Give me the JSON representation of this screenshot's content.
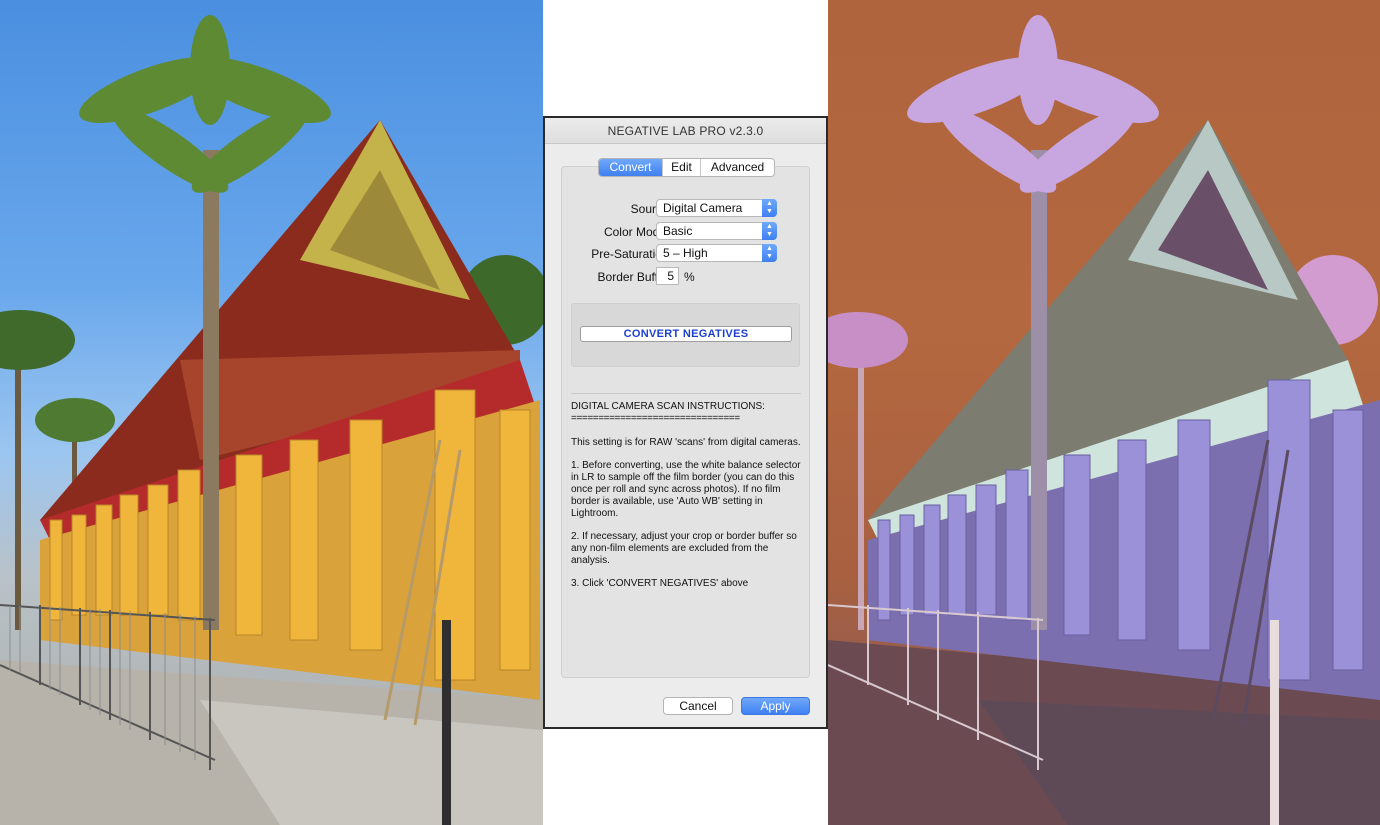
{
  "dialog": {
    "title": "NEGATIVE LAB PRO v2.3.0",
    "tabs": [
      {
        "label": "Convert",
        "active": true
      },
      {
        "label": "Edit",
        "active": false
      },
      {
        "label": "Advanced",
        "active": false
      }
    ],
    "fields": {
      "source": {
        "label": "Source:",
        "value": "Digital Camera"
      },
      "color_model": {
        "label": "Color Model:",
        "value": "Basic"
      },
      "pre_saturation": {
        "label": "Pre-Saturation:",
        "value": "5 – High"
      },
      "border_buffer": {
        "label": "Border Buffer:",
        "value": "5",
        "unit": "%"
      }
    },
    "convert_button": "CONVERT NEGATIVES",
    "instructions": {
      "heading": "DIGITAL CAMERA SCAN INSTRUCTIONS:",
      "rule": "===============================",
      "intro": "This setting is for RAW 'scans' from digital cameras.",
      "step1": "1. Before converting, use the white balance selector in LR to sample off the film border (you can do this once per roll and sync across photos). If no film border is available, use 'Auto WB' setting in Lightroom.",
      "step2": "2. If necessary, adjust your crop or border buffer so any non-film elements are excluded from the analysis.",
      "step3": "3. Click 'CONVERT NEGATIVES' above"
    },
    "cancel_label": "Cancel",
    "apply_label": "Apply",
    "accent_color": "#3f80f2"
  }
}
